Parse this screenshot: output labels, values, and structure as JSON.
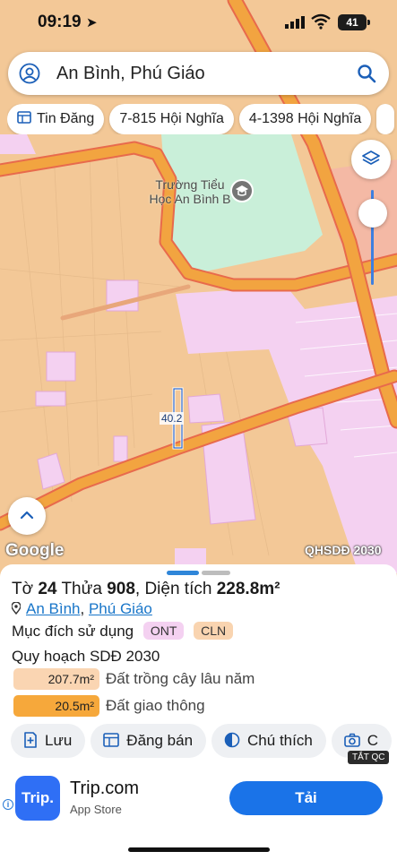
{
  "status_bar": {
    "time": "09:19",
    "battery": "41"
  },
  "search": {
    "text": "An Bình, Phú Giáo"
  },
  "chips": [
    {
      "label": "Tin Đăng",
      "icon": "listing-icon"
    },
    {
      "label": "7-815 Hội Nghĩa"
    },
    {
      "label": "4-1398 Hội Nghĩa"
    }
  ],
  "map": {
    "school_label": "Trường Tiểu Học An Bình B",
    "dimension_label": "40.2",
    "attribution": "Google",
    "layer_label": "QHSDĐ 2030"
  },
  "parcel": {
    "sheet_prefix": "Tờ",
    "sheet_no": "24",
    "plot_prefix": "Thửa",
    "plot_no": "908",
    "area_prefix": ", Diện tích",
    "area": "228.8m²",
    "commune": "An Bình",
    "separator": ",",
    "district": "Phú Giáo",
    "usage_label": "Mục đích sử dụng",
    "usage_tags": [
      "ONT",
      "CLN"
    ],
    "plan_title": "Quy hoạch SDĐ 2030",
    "land_types": [
      {
        "area": "207.7m²",
        "desc": "Đất trồng cây lâu năm",
        "color": "#fad5b2"
      },
      {
        "area": "20.5m²",
        "desc": "Đất giao thông",
        "color": "#f6a83b"
      }
    ]
  },
  "actions": [
    {
      "label": "Lưu",
      "icon": "save-icon"
    },
    {
      "label": "Đăng bán",
      "icon": "post-listing-icon"
    },
    {
      "label": "Chú thích",
      "icon": "legend-icon"
    },
    {
      "label": "C",
      "icon": "camera-icon"
    }
  ],
  "ad": {
    "tag": "TẮT QC",
    "logo_text": "Trip.",
    "name": "Trip.com",
    "store": "App Store",
    "install": "Tải",
    "info": "i"
  },
  "colors": {
    "accent": "#1a73e8",
    "residential": "#f4d1f1",
    "perennial": "#fad5b2",
    "road": "#f6a83b",
    "school": "#c9efd9"
  }
}
